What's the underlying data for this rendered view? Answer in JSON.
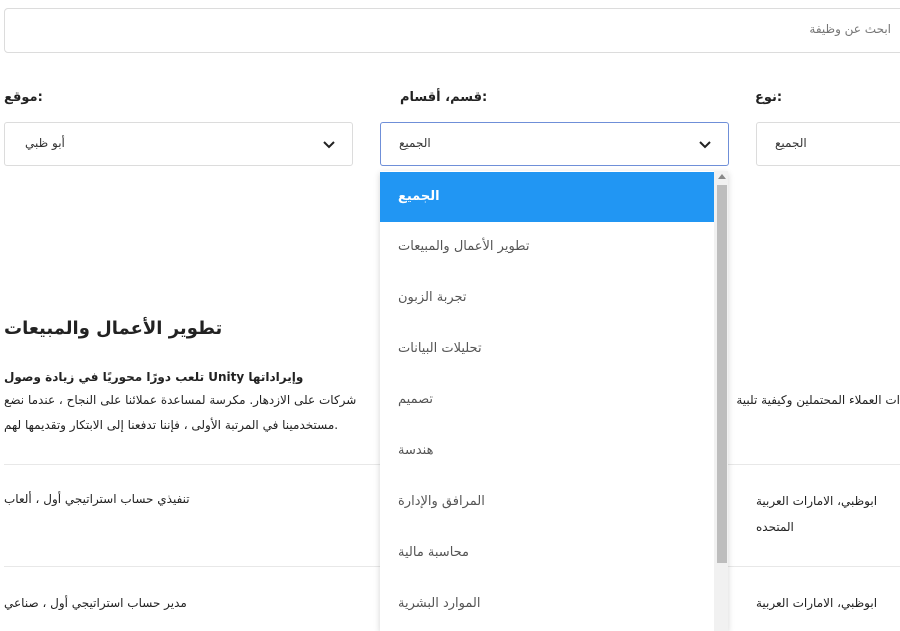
{
  "search": {
    "placeholder": "ابحث عن وظيفة"
  },
  "filters": {
    "location": {
      "label": ":موقع",
      "value": "أبو ظبي"
    },
    "department": {
      "label": ":قسم، أقسام",
      "value": "الجميع"
    },
    "type": {
      "label": ":نوع",
      "value": "الجميع"
    }
  },
  "dropdown": {
    "options": [
      "الجميع",
      "تطوير الأعمال والمبيعات",
      "تجربة الزبون",
      "تحليلات البيانات",
      "تصميم",
      "هندسة",
      "المرافق والإدارة",
      "محاسبة مالية",
      "الموارد البشرية"
    ],
    "selected": "الجميع"
  },
  "section": {
    "title": "تطوير الأعمال والمبيعات",
    "desc_line1_left": "وإيراداتها Unity تلعب دورًا محوريًا في زيادة وصول",
    "desc_line2_left": "شركات على الازدهار. مكرسة لمساعدة عملائنا على النجاح ، عندما نضع",
    "desc_line2_right": "ات العملاء المحتملين وكيفية تلبية",
    "desc_line3_left": ".مستخدمينا في المرتبة الأولى ، فإننا تدفعنا إلى الابتكار وتقديمها لهم"
  },
  "jobs": [
    {
      "title": "تنفيذي حساب استراتيجي أول ، ألعاب",
      "location_line1": "ابوظبي، الامارات العربية",
      "location_line2": "المتحده"
    },
    {
      "title": "مدير حساب استراتيجي أول ، صناعي",
      "location_line1": "ابوظبي، الامارات العربية",
      "location_line2": ""
    }
  ]
}
